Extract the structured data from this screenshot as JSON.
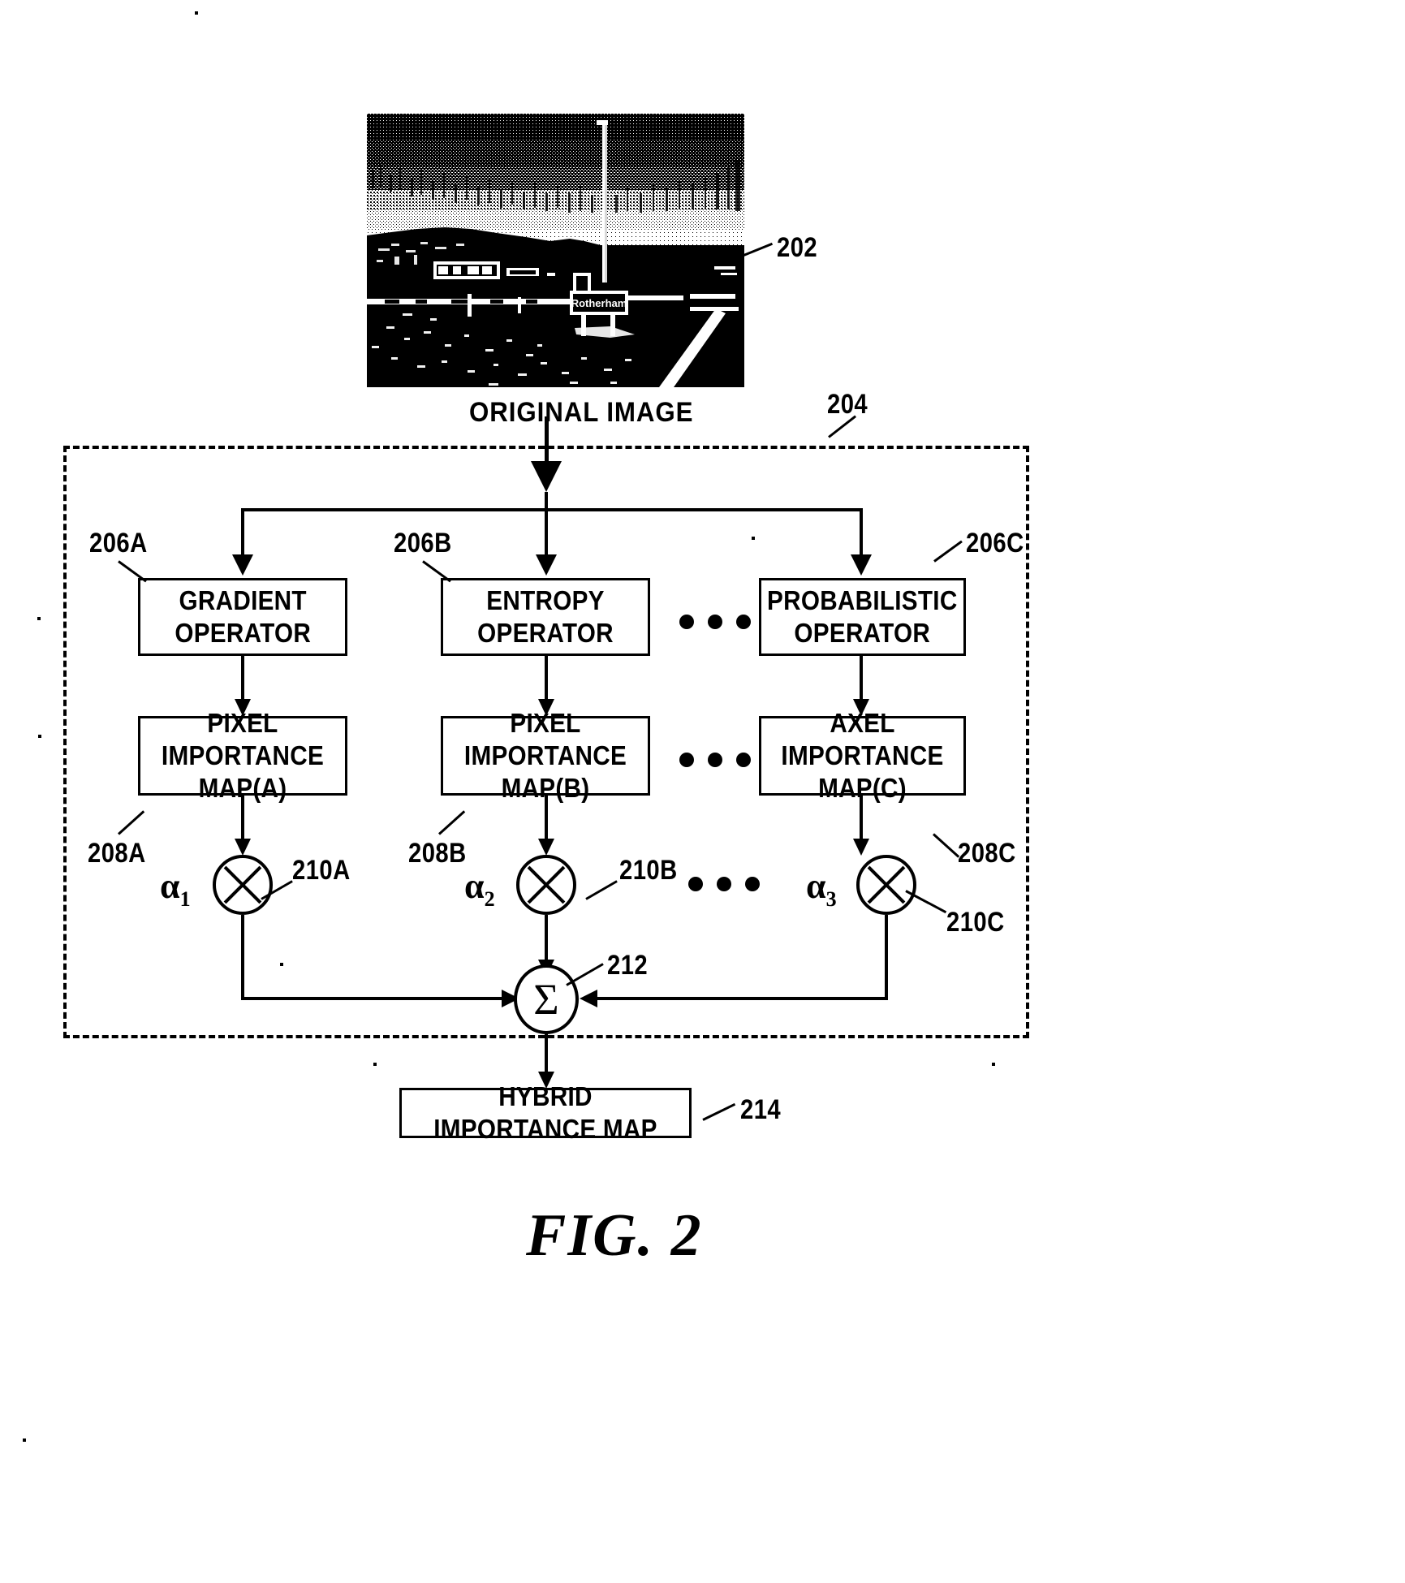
{
  "figure": {
    "label": "FIG. 2",
    "caption_original_image": "ORIGINAL IMAGE"
  },
  "photo": {
    "ref": "202",
    "sign_text": "Rotherham",
    "description": "halftone photograph of a roadside scene with a Rotherham town sign"
  },
  "container": {
    "ref": "204"
  },
  "operators": [
    {
      "ref": "206A",
      "label": "GRADIENT\nOPERATOR"
    },
    {
      "ref": "206B",
      "label": "ENTROPY OPERATOR"
    },
    {
      "ref": "206C",
      "label": "PROBABILISTIC\nOPERATOR"
    }
  ],
  "maps": [
    {
      "ref": "208A",
      "label": "PIXEL IMPORTANCE\nMAP(A)"
    },
    {
      "ref": "208B",
      "label": "PIXEL IMPORTANCE\nMAP(B)"
    },
    {
      "ref": "208C",
      "label": "AXEL IMPORTANCE\nMAP(C)"
    }
  ],
  "multipliers": [
    {
      "ref": "210A",
      "coefficient": "α",
      "subscript": "1",
      "symbol": "multiply-circle"
    },
    {
      "ref": "210B",
      "coefficient": "α",
      "subscript": "2",
      "symbol": "multiply-circle"
    },
    {
      "ref": "210C",
      "coefficient": "α",
      "subscript": "3",
      "symbol": "multiply-circle"
    }
  ],
  "summation": {
    "ref": "212",
    "symbol": "Σ"
  },
  "output": {
    "ref": "214",
    "label": "HYBRID IMPORTANCE MAP"
  },
  "ellipsis": {
    "glyph": "•••"
  },
  "colors": {
    "ink": "#000000",
    "paper": "#ffffff"
  }
}
